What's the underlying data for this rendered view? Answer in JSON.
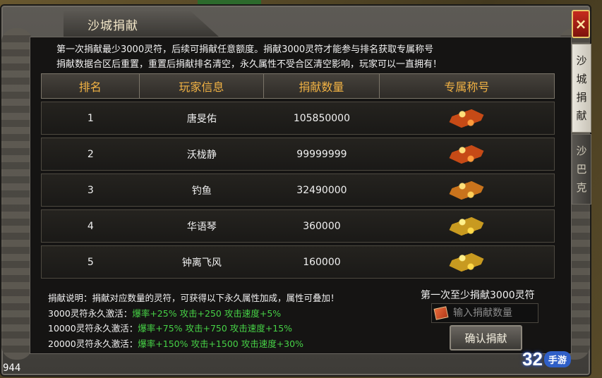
{
  "panel": {
    "title": "沙城捐献",
    "close_label": "×",
    "description_lines": [
      "第一次捐献最少3000灵符，后续可捐献任意额度。捐献3000灵符才能参与排名获取专属称号",
      "捐献数据合区后重置，重置后捐献排名清空，永久属性不受合区清空影响，玩家可以一直拥有！"
    ]
  },
  "side_tabs": [
    {
      "label": "沙城捐献",
      "active": true
    },
    {
      "label": "沙巴克",
      "active": false
    }
  ],
  "table": {
    "headers": [
      "排名",
      "玩家信息",
      "捐献数量",
      "专属称号"
    ],
    "rows": [
      {
        "rank": "1",
        "player": "唐旻佑",
        "amount": "105850000",
        "title_icon": "red-title-badge-icon"
      },
      {
        "rank": "2",
        "player": "沃栊静",
        "amount": "99999999",
        "title_icon": "red-title-badge-icon"
      },
      {
        "rank": "3",
        "player": "钓鱼",
        "amount": "32490000",
        "title_icon": "orange-title-badge-icon"
      },
      {
        "rank": "4",
        "player": "华语琴",
        "amount": "360000",
        "title_icon": "gold-title-badge-icon"
      },
      {
        "rank": "5",
        "player": "钟离飞风",
        "amount": "160000",
        "title_icon": "gold-title-badge-icon"
      }
    ]
  },
  "bonus": {
    "intro": "捐献说明：捐献对应数量的灵符，可获得以下永久属性加成，属性可叠加！",
    "tiers": [
      {
        "label": "3000灵符永久激活：",
        "effect": "爆率+25% 攻击+250 攻击速度+5%"
      },
      {
        "label": "10000灵符永久激活：",
        "effect": "爆率+75% 攻击+750 攻击速度+15%"
      },
      {
        "label": "20000灵符永久激活：",
        "effect": "爆率+150% 攻击+1500 攻击速度+30%"
      }
    ]
  },
  "donate": {
    "min_note": "第一次至少捐献3000灵符",
    "input_value": "",
    "input_placeholder": "输入捐献数量",
    "confirm_label": "确认捐献"
  },
  "fps_counter": "944",
  "watermark": {
    "number": "32",
    "text": "手游"
  },
  "colors": {
    "header_text": "#f1b244",
    "bonus_green": "#46d146",
    "close_red": "#c62b1e"
  }
}
